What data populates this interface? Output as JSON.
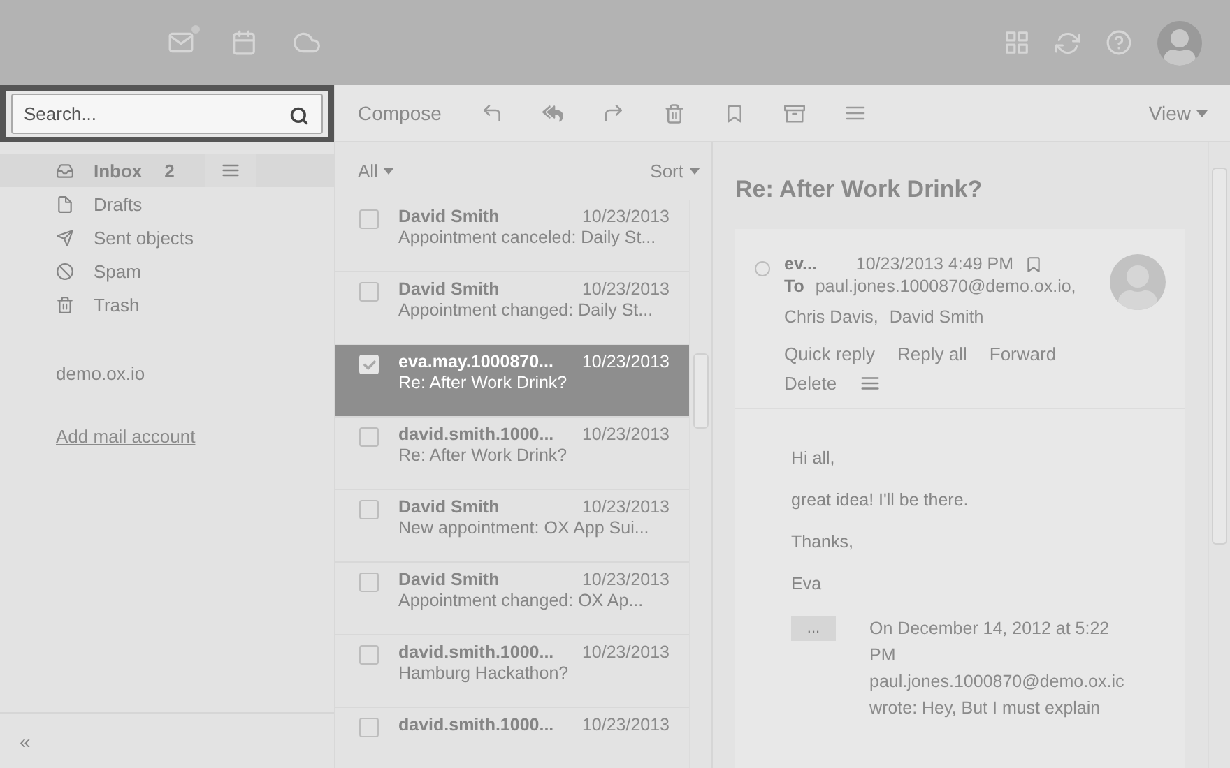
{
  "search": {
    "placeholder": "Search..."
  },
  "toolbar": {
    "compose": "Compose",
    "view": "View"
  },
  "folders": [
    {
      "kind": "inbox",
      "label": "Inbox",
      "count": "2",
      "selected": true
    },
    {
      "kind": "drafts",
      "label": "Drafts",
      "selected": false
    },
    {
      "kind": "sent",
      "label": "Sent objects",
      "selected": false
    },
    {
      "kind": "spam",
      "label": "Spam",
      "selected": false
    },
    {
      "kind": "trash",
      "label": "Trash",
      "selected": false
    }
  ],
  "account": "demo.ox.io",
  "add_account": "Add mail account",
  "collapse": "«",
  "list": {
    "filter": "All",
    "sort": "Sort",
    "messages": [
      {
        "sender": "David Smith",
        "date": "10/23/2013",
        "subject": "Appointment canceled: Daily St...",
        "selected": false
      },
      {
        "sender": "David Smith",
        "date": "10/23/2013",
        "subject": "Appointment changed: Daily St...",
        "selected": false
      },
      {
        "sender": "eva.may.1000870...",
        "date": "10/23/2013",
        "subject": "Re: After Work Drink?",
        "selected": true
      },
      {
        "sender": "david.smith.1000...",
        "date": "10/23/2013",
        "subject": "Re: After Work Drink?",
        "selected": false
      },
      {
        "sender": "David Smith",
        "date": "10/23/2013",
        "subject": "New appointment: OX App Sui...",
        "selected": false
      },
      {
        "sender": "David Smith",
        "date": "10/23/2013",
        "subject": "Appointment changed: OX Ap...",
        "selected": false
      },
      {
        "sender": "david.smith.1000...",
        "date": "10/23/2013",
        "subject": "Hamburg Hackathon?",
        "selected": false
      },
      {
        "sender": "david.smith.1000...",
        "date": "10/23/2013",
        "selected": false
      }
    ]
  },
  "detail": {
    "subject": "Re: After Work Drink?",
    "sender": "ev...",
    "date": "10/23/2013 4:49 PM",
    "to_label": "To",
    "recipients": [
      "paul.jones.1000870@demo.ox.io,",
      "Chris Davis,",
      "David Smith"
    ],
    "actions": [
      "Quick reply",
      "Reply all",
      "Forward",
      "Delete"
    ],
    "body": [
      "Hi all,",
      "great idea! I'll be there.",
      "Thanks,",
      "Eva"
    ],
    "quote_toggle": "...",
    "quote": "On December 14, 2012 at 5:22 PM paul.jones.1000870@demo.ox.ic wrote: Hey, But I must explain"
  }
}
